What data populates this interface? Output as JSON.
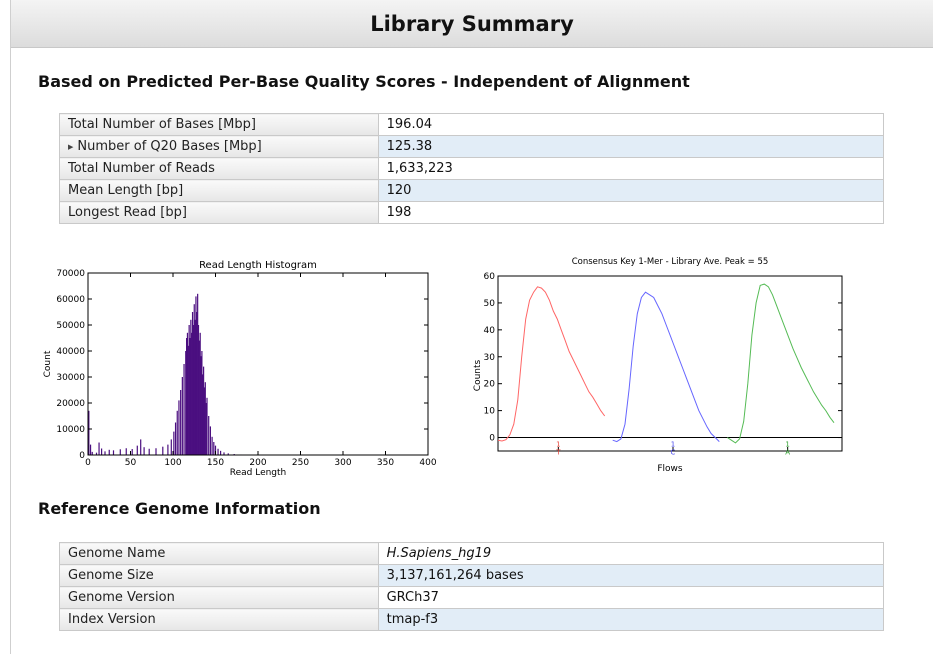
{
  "header": {
    "title": "Library Summary"
  },
  "quality_section": {
    "heading": "Based on Predicted Per-Base Quality Scores - Independent of Alignment",
    "rows": [
      {
        "label": "Total Number of Bases [Mbp]",
        "value": "196.04"
      },
      {
        "label": "Number of Q20 Bases [Mbp]",
        "value": "125.38"
      },
      {
        "label": "Total Number of Reads",
        "value": "1,633,223"
      },
      {
        "label": "Mean Length [bp]",
        "value": "120"
      },
      {
        "label": "Longest Read [bp]",
        "value": "198"
      }
    ]
  },
  "reference_section": {
    "heading": "Reference Genome Information",
    "rows": [
      {
        "label": "Genome Name",
        "value": "H.Sapiens_hg19"
      },
      {
        "label": "Genome Size",
        "value": "3,137,161,264 bases"
      },
      {
        "label": "Genome Version",
        "value": "GRCh37"
      },
      {
        "label": "Index Version",
        "value": "tmap-f3"
      }
    ]
  },
  "chart_data": [
    {
      "type": "bar",
      "title": "Read Length Histogram",
      "xlabel": "Read Length",
      "ylabel": "Count",
      "xlim": [
        0,
        400
      ],
      "ylim": [
        0,
        70000
      ],
      "xticks": [
        0,
        50,
        100,
        150,
        200,
        250,
        300,
        350,
        400
      ],
      "yticks": [
        0,
        10000,
        20000,
        30000,
        40000,
        50000,
        60000,
        70000
      ],
      "color": "#4b0f80",
      "bins": [
        [
          1,
          17000
        ],
        [
          3,
          4000
        ],
        [
          5,
          1200
        ],
        [
          10,
          900
        ],
        [
          13,
          4800
        ],
        [
          16,
          2500
        ],
        [
          20,
          1400
        ],
        [
          25,
          2000
        ],
        [
          30,
          1800
        ],
        [
          38,
          2200
        ],
        [
          45,
          2600
        ],
        [
          52,
          2300
        ],
        [
          58,
          3600
        ],
        [
          62,
          6000
        ],
        [
          66,
          3000
        ],
        [
          72,
          2400
        ],
        [
          80,
          2600
        ],
        [
          88,
          3200
        ],
        [
          94,
          4000
        ],
        [
          98,
          6000
        ],
        [
          101,
          9000
        ],
        [
          103,
          12500
        ],
        [
          105,
          17000
        ],
        [
          107,
          21000
        ],
        [
          109,
          25000
        ],
        [
          111,
          30000
        ],
        [
          113,
          35000
        ],
        [
          115,
          40000
        ],
        [
          116,
          45000
        ],
        [
          117,
          47000
        ],
        [
          118,
          42000
        ],
        [
          119,
          50000
        ],
        [
          120,
          45000
        ],
        [
          121,
          52000
        ],
        [
          122,
          47000
        ],
        [
          123,
          55000
        ],
        [
          124,
          50000
        ],
        [
          125,
          58000
        ],
        [
          126,
          52000
        ],
        [
          127,
          61000
        ],
        [
          128,
          55000
        ],
        [
          129,
          62000
        ],
        [
          130,
          50000
        ],
        [
          131,
          44000
        ],
        [
          132,
          47000
        ],
        [
          133,
          38000
        ],
        [
          134,
          40000
        ],
        [
          135,
          31000
        ],
        [
          136,
          34000
        ],
        [
          137,
          26000
        ],
        [
          138,
          28000
        ],
        [
          139,
          20000
        ],
        [
          140,
          22000
        ],
        [
          142,
          15000
        ],
        [
          144,
          11000
        ],
        [
          146,
          7000
        ],
        [
          148,
          5000
        ],
        [
          150,
          3600
        ],
        [
          153,
          2400
        ],
        [
          156,
          1600
        ],
        [
          160,
          1000
        ],
        [
          165,
          650
        ],
        [
          172,
          380
        ],
        [
          180,
          200
        ],
        [
          190,
          80
        ],
        [
          198,
          30
        ]
      ]
    },
    {
      "type": "line",
      "title": "Consensus Key 1-Mer - Library Ave. Peak = 55",
      "xlabel": "Flows",
      "ylabel": "Counts",
      "ylim": [
        -5,
        60
      ],
      "yticks": [
        0,
        10,
        20,
        30,
        40,
        50,
        60
      ],
      "flow_labels": [
        {
          "num": "1",
          "base": "T",
          "color": "#e8433a"
        },
        {
          "num": "1",
          "base": "C",
          "color": "#4444ee"
        },
        {
          "num": "1",
          "base": "A",
          "color": "#2ca02c"
        }
      ],
      "series": [
        {
          "color": "#ff6666",
          "values": [
            [
              0,
              -1
            ],
            [
              1,
              -1.3
            ],
            [
              2,
              -0.8
            ],
            [
              3,
              1
            ],
            [
              4,
              5
            ],
            [
              5,
              14
            ],
            [
              6,
              30
            ],
            [
              7,
              44
            ],
            [
              8,
              51
            ],
            [
              9,
              54
            ],
            [
              10,
              56
            ],
            [
              11,
              55.5
            ],
            [
              12,
              54
            ],
            [
              13,
              51
            ],
            [
              14,
              47
            ],
            [
              15,
              44
            ],
            [
              16,
              40
            ],
            [
              17,
              36
            ],
            [
              18,
              32
            ],
            [
              19,
              29
            ],
            [
              20,
              26
            ],
            [
              21,
              23
            ],
            [
              22,
              20
            ],
            [
              23,
              17
            ],
            [
              24,
              15
            ],
            [
              25,
              12.5
            ],
            [
              26,
              10
            ],
            [
              27,
              8
            ]
          ]
        },
        {
          "color": "#6666ff",
          "values": [
            [
              0,
              -1
            ],
            [
              1,
              -1.5
            ],
            [
              2,
              -0.5
            ],
            [
              3,
              5
            ],
            [
              4,
              18
            ],
            [
              5,
              34
            ],
            [
              6,
              46
            ],
            [
              7,
              52
            ],
            [
              8,
              54
            ],
            [
              9,
              53
            ],
            [
              10,
              52
            ],
            [
              11,
              49
            ],
            [
              12,
              46
            ],
            [
              13,
              42
            ],
            [
              14,
              38
            ],
            [
              15,
              34
            ],
            [
              16,
              30
            ],
            [
              17,
              26
            ],
            [
              18,
              22
            ],
            [
              19,
              18
            ],
            [
              20,
              14
            ],
            [
              21,
              10
            ],
            [
              22,
              7
            ],
            [
              23,
              4
            ],
            [
              24,
              1.5
            ],
            [
              25,
              0
            ],
            [
              26,
              -1.5
            ]
          ]
        },
        {
          "color": "#55bb55",
          "values": [
            [
              0,
              0
            ],
            [
              1,
              -1
            ],
            [
              2,
              -2
            ],
            [
              3,
              -0.5
            ],
            [
              4,
              6
            ],
            [
              5,
              20
            ],
            [
              6,
              38
            ],
            [
              7,
              50
            ],
            [
              8,
              56.5
            ],
            [
              9,
              57
            ],
            [
              10,
              56
            ],
            [
              11,
              53
            ],
            [
              12,
              49
            ],
            [
              13,
              45
            ],
            [
              14,
              41
            ],
            [
              15,
              37
            ],
            [
              16,
              33
            ],
            [
              17,
              29.5
            ],
            [
              18,
              26
            ],
            [
              19,
              23
            ],
            [
              20,
              20
            ],
            [
              21,
              17
            ],
            [
              22,
              14.5
            ],
            [
              23,
              12
            ],
            [
              24,
              10
            ],
            [
              25,
              7.5
            ],
            [
              26,
              5.5
            ]
          ]
        }
      ]
    }
  ]
}
